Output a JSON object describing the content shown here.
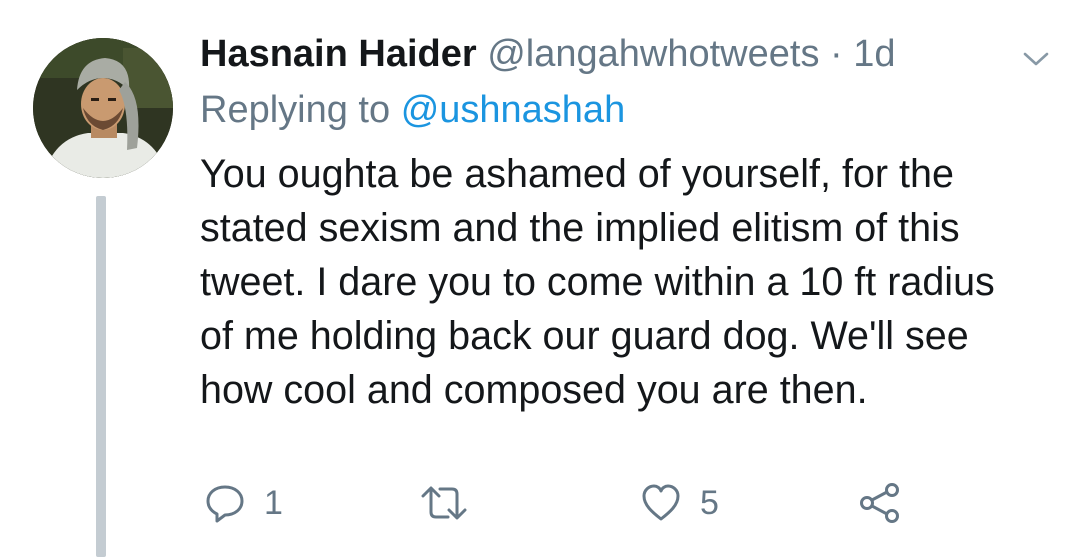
{
  "tweet": {
    "display_name": "Hasnain Haider",
    "handle": "@langahwhotweets",
    "separator": "·",
    "timestamp": "1d",
    "replying_prefix": "Replying to",
    "replying_to": "@ushnashah",
    "lines": [
      "You oughta be ashamed of yourself, for the",
      "stated sexism and the implied elitism of this",
      "tweet. I dare you to come within a 10 ft radius",
      "of me holding back our guard dog. We'll see",
      "how cool and composed you are then."
    ],
    "actions": {
      "reply_count": "1",
      "retweet_count": "",
      "like_count": "5"
    },
    "icons": {
      "caret": "chevron-down-icon",
      "reply": "reply-icon",
      "retweet": "retweet-icon",
      "like": "heart-icon",
      "share": "share-icon"
    },
    "colors": {
      "text": "#14171a",
      "secondary": "#657786",
      "link": "#1b95e0",
      "thread_line": "#c4ccd2"
    }
  }
}
